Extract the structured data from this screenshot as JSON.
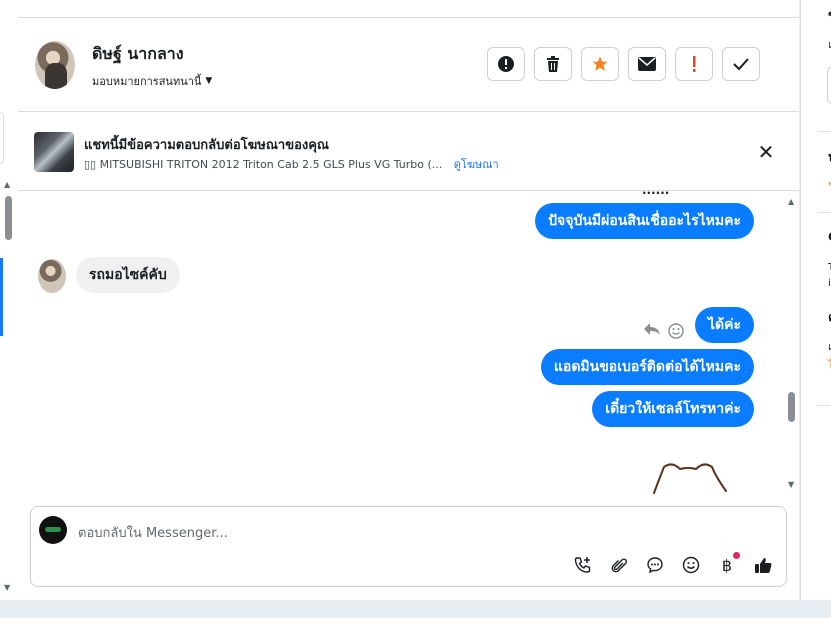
{
  "contact": {
    "name": "ดิษฐ์ นากลาง",
    "assign_label": "มอบหมายการสนทนานี้"
  },
  "ad": {
    "title": "แชทนี้มีข้อความตอบกลับต่อโฆษณาของคุณ",
    "subtitle": "▯▯ MITSUBISHI TRITON 2012 Triton Cab 2.5 GLS Plus VG Turbo (...",
    "link": "ดูโฆษณา"
  },
  "messages": {
    "cut_top": "......",
    "out_1": "ปัจจุบันมีผ่อนสินเชื่ออะไรไหมคะ",
    "in_1": "รถมอไซค์คับ",
    "out_2": "ได้ค่ะ",
    "out_3": "แอดมินขอเบอร์ติดต่อได้ไหมคะ",
    "out_4": "เดี๋ยวให้เซลล์โทรหาค่ะ"
  },
  "composer": {
    "placeholder": "ตอบกลับใน Messenger..."
  },
  "colors": {
    "accent": "#1877f2",
    "bubble_out": "#0a7cff",
    "star": "#f5821f",
    "alert": "#e4422a"
  }
}
